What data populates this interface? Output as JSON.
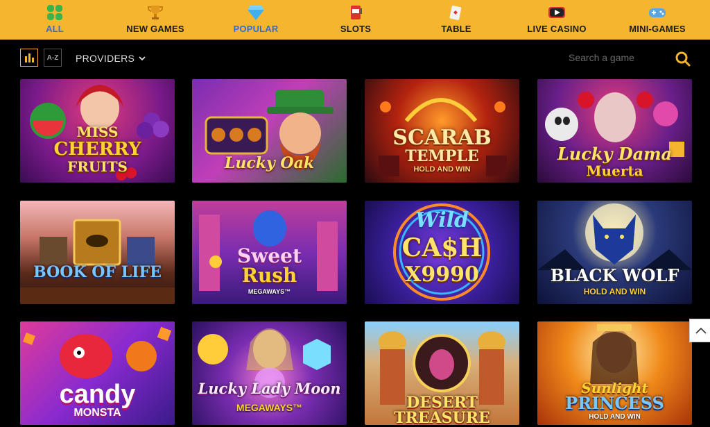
{
  "nav": {
    "items": [
      {
        "label": "ALL",
        "icon": "clover-icon"
      },
      {
        "label": "NEW GAMES",
        "icon": "trophy-icon"
      },
      {
        "label": "POPULAR",
        "icon": "diamond-icon"
      },
      {
        "label": "SLOTS",
        "icon": "slot-machine-icon"
      },
      {
        "label": "TABLE",
        "icon": "playing-card-icon"
      },
      {
        "label": "LIVE CASINO",
        "icon": "play-icon"
      },
      {
        "label": "MINI-GAMES",
        "icon": "gamepad-icon"
      }
    ]
  },
  "toolbar": {
    "az_label": "A-Z",
    "providers_label": "PROVIDERS",
    "search_placeholder": "Search a game"
  },
  "games": [
    {
      "title1": "MISS",
      "title2": "CHERRY",
      "title3": "FRUITS"
    },
    {
      "title1": "Lucky Oak"
    },
    {
      "title1": "SCARAB",
      "title2": "TEMPLE",
      "sub": "HOLD AND WIN"
    },
    {
      "title1": "Lucky Dama",
      "title2": "Muerta"
    },
    {
      "title1": "BOOK OF LIFE"
    },
    {
      "title1": "Sweet",
      "title2": "Rush",
      "sub": "MEGAWAYS™"
    },
    {
      "title1": "Wild",
      "title2": "CA$H",
      "title3": "X9990"
    },
    {
      "title1": "BLACK WOLF",
      "sub": "HOLD AND WIN"
    },
    {
      "title1": "candy",
      "title2": "MONSTA"
    },
    {
      "title1": "Lucky Lady Moon",
      "sub": "MEGAWAYS™"
    },
    {
      "title1": "DESERT TREASURE"
    },
    {
      "title1": "Sunlight",
      "title2": "PRINCESS",
      "sub": "HOLD AND WIN"
    }
  ],
  "colors": {
    "accent": "#f5b52e",
    "active": "#2e6fd8",
    "bg": "#000000"
  }
}
